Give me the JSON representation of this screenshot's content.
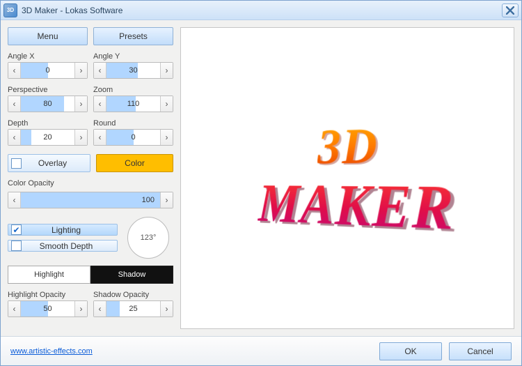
{
  "window": {
    "title": "3D Maker - Lokas Software"
  },
  "buttons": {
    "menu": "Menu",
    "presets": "Presets"
  },
  "params": {
    "angleX": {
      "label": "Angle X",
      "value": 0,
      "fillPct": 50
    },
    "angleY": {
      "label": "Angle Y",
      "value": 30,
      "fillPct": 58
    },
    "perspective": {
      "label": "Perspective",
      "value": 80,
      "fillPct": 80
    },
    "zoom": {
      "label": "Zoom",
      "value": 110,
      "fillPct": 55
    },
    "depth": {
      "label": "Depth",
      "value": 20,
      "fillPct": 20
    },
    "round": {
      "label": "Round",
      "value": 0,
      "fillPct": 50
    }
  },
  "overlay": {
    "label": "Overlay",
    "checked": false
  },
  "color": {
    "label": "Color",
    "swatch": "#ffbe00"
  },
  "colorOpacity": {
    "label": "Color Opacity",
    "value": 100,
    "fillPct": 100
  },
  "lighting": {
    "label": "Lighting",
    "checked": true,
    "angle": "123°"
  },
  "smoothDepth": {
    "label": "Smooth Depth",
    "checked": false
  },
  "segments": {
    "highlight": "Highlight",
    "shadow": "Shadow",
    "active": "shadow"
  },
  "highlightOpacity": {
    "label": "Highlight Opacity",
    "value": 50,
    "fillPct": 50
  },
  "shadowOpacity": {
    "label": "Shadow Opacity",
    "value": 25,
    "fillPct": 25
  },
  "preview": {
    "line1": "3D",
    "line2": "MAKER"
  },
  "footer": {
    "link": "www.artistic-effects.com",
    "ok": "OK",
    "cancel": "Cancel"
  }
}
